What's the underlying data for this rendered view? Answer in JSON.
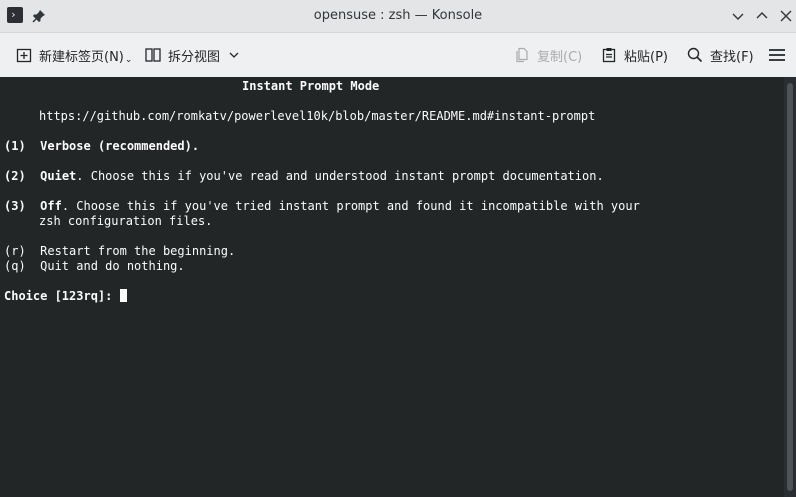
{
  "window": {
    "title": "opensuse : zsh — Konsole",
    "app_icon": "terminal-icon",
    "app_icon_glyph": "›"
  },
  "toolbar": {
    "new_tab_label": "新建标签页(N)",
    "new_tab_caret": "⌄",
    "split_view_label": "拆分视图",
    "copy_label": "复制(C)",
    "paste_label": "粘贴(P)",
    "find_label": "查找(F)"
  },
  "terminal": {
    "header": "Instant Prompt Mode",
    "url": "https://github.com/romkatv/powerlevel10k/blob/master/README.md#instant-prompt",
    "opt1_num": "(1)",
    "opt1_bold": "Verbose (recommended).",
    "opt2_num": "(2)",
    "opt2_bold": "Quiet",
    "opt2_rest": ". Choose this if you've read and understood instant prompt documentation.",
    "opt3_num": "(3)",
    "opt3_bold": "Off",
    "opt3_rest": ". Choose this if you've tried instant prompt and found it incompatible with your",
    "opt3_cont": "zsh configuration files.",
    "optr": "(r)  Restart from the beginning.",
    "optq": "(q)  Quit and do nothing.",
    "prompt": "Choice [123rq]: "
  },
  "colors": {
    "terminal_bg": "#232627",
    "terminal_fg": "#fcfcfc",
    "titlebar_bg": "#e3e5e7",
    "toolbar_bg": "#eff0f1"
  }
}
